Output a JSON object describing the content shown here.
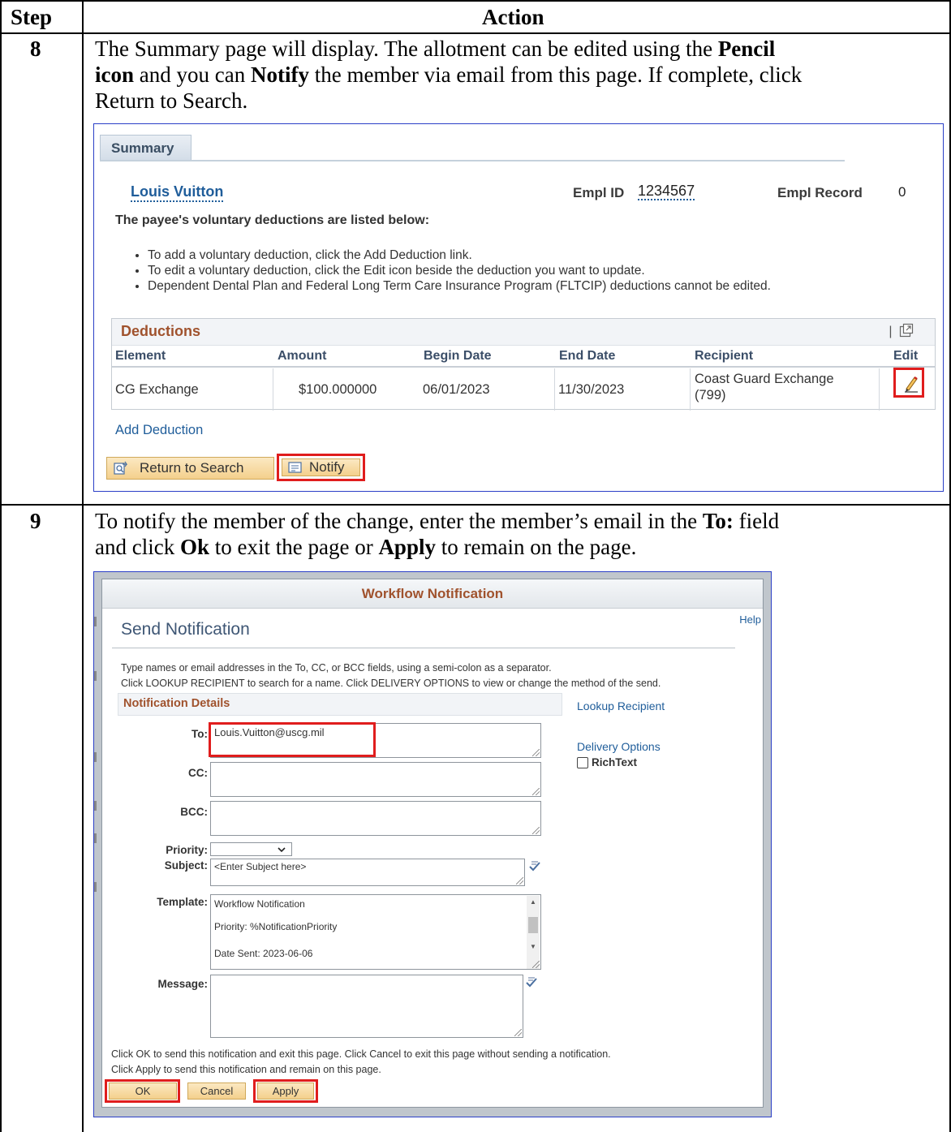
{
  "table": {
    "header_step": "Step",
    "header_action": "Action"
  },
  "step8": {
    "number": "8",
    "instr_p1": "The Summary page will display. The allotment can be edited using the ",
    "instr_b1": "Pencil",
    "instr_b2": "icon",
    "instr_p2": " and you can ",
    "instr_b3": "Notify",
    "instr_p3": " the member via email from this page. If complete, click",
    "instr_line3": "Return to Search."
  },
  "summary": {
    "tab_label": "Summary",
    "name": "Louis Vuitton",
    "emplid_label": "Empl ID",
    "emplid_value": "1234567",
    "emplrec_label": "Empl Record",
    "emplrec_value": "0",
    "intro": "The payee's voluntary deductions are listed below:",
    "bullets": [
      "To add a voluntary deduction, click the Add Deduction link.",
      "To edit a voluntary deduction, click the Edit icon beside the deduction you want to update.",
      "Dependent Dental Plan and Federal Long Term Care Insurance Program (FLTCIP) deductions cannot be edited."
    ],
    "deductions": {
      "title": "Deductions",
      "grid_icons": "|",
      "columns": [
        "Element",
        "Amount",
        "Begin Date",
        "End Date",
        "Recipient",
        "Edit"
      ],
      "row": {
        "element": "CG Exchange",
        "amount": "$100.000000",
        "begin_date": "06/01/2023",
        "end_date": "11/30/2023",
        "recipient_line1": "Coast Guard Exchange",
        "recipient_line2": "(799)"
      }
    },
    "add_deduction": "Add Deduction",
    "return_button": "Return to Search",
    "notify_button": "Notify"
  },
  "step9": {
    "number": "9",
    "instr_p1": "To notify the member of the change, enter the member’s email in the ",
    "instr_b1": "To:",
    "instr_p2": " field",
    "instr_p3": "and click ",
    "instr_b2": "Ok",
    "instr_p4": " to exit the page or ",
    "instr_b3": "Apply",
    "instr_p5": " to remain on the page."
  },
  "workflow": {
    "title": "Workflow Notification",
    "help": "Help",
    "send_title": "Send Notification",
    "instr_line1": "Type names or email addresses in the To, CC, or BCC fields, using a semi-colon as a separator.",
    "instr_line2": "Click LOOKUP RECIPIENT to search for a name.  Click DELIVERY OPTIONS to view or change the method of the send.",
    "details_title": "Notification Details",
    "lookup_recipient": "Lookup Recipient",
    "delivery_options": "Delivery Options",
    "richtext_label": "RichText",
    "richtext_checked": false,
    "to_label": "To:",
    "to_value": "Louis.Vuitton@uscg.mil",
    "cc_label": "CC:",
    "cc_value": "",
    "bcc_label": "BCC:",
    "bcc_value": "",
    "priority_label": "Priority:",
    "priority_value": "",
    "subject_label": "Subject:",
    "subject_value": "<Enter Subject here>",
    "template_label": "Template:",
    "template_lines": [
      "Workflow Notification",
      "Priority:  %NotificationPriority",
      "Date Sent:  2023-06-06"
    ],
    "message_label": "Message:",
    "message_value": "",
    "footer_line1": "Click OK to send this notification and exit this page.  Click Cancel to exit this page without sending a notification.",
    "footer_line2": "Click Apply to send this notification and remain on this page.",
    "ok_button": "OK",
    "cancel_button": "Cancel",
    "apply_button": "Apply"
  },
  "colors": {
    "highlight_red": "#e01d1d",
    "link_blue": "#1f5d9a",
    "section_brown": "#a0522d",
    "screenshot_border": "#2b3fc7",
    "button_orange": "#f4d08c"
  }
}
